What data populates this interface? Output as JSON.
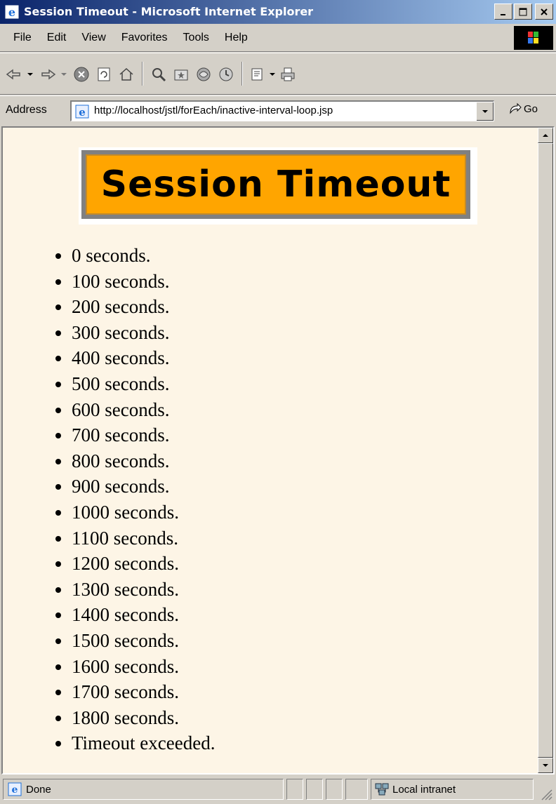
{
  "window": {
    "title": "Session Timeout - Microsoft Internet Explorer",
    "controls": [
      "minimize-icon",
      "maximize-icon",
      "close-icon"
    ]
  },
  "menu": {
    "items": [
      "File",
      "Edit",
      "View",
      "Favorites",
      "Tools",
      "Help"
    ]
  },
  "toolbar": {
    "icons": [
      "back-icon",
      "forward-icon",
      "stop-icon",
      "refresh-icon",
      "home-icon",
      "search-icon",
      "favorites-icon",
      "media-icon",
      "history-icon",
      "mail-icon",
      "print-icon"
    ]
  },
  "address": {
    "label": "Address",
    "url": "http://localhost/jstl/forEach/inactive-interval-loop.jsp",
    "go_label": "Go"
  },
  "page": {
    "banner_title": "Session Timeout",
    "banner_color": "#ffa500",
    "background_color": "#fdf5e6",
    "items": [
      "0 seconds.",
      "100 seconds.",
      "200 seconds.",
      "300 seconds.",
      "400 seconds.",
      "500 seconds.",
      "600 seconds.",
      "700 seconds.",
      "800 seconds.",
      "900 seconds.",
      "1000 seconds.",
      "1100 seconds.",
      "1200 seconds.",
      "1300 seconds.",
      "1400 seconds.",
      "1500 seconds.",
      "1600 seconds.",
      "1700 seconds.",
      "1800 seconds.",
      "Timeout exceeded."
    ]
  },
  "status": {
    "text": "Done",
    "zone": "Local intranet"
  }
}
